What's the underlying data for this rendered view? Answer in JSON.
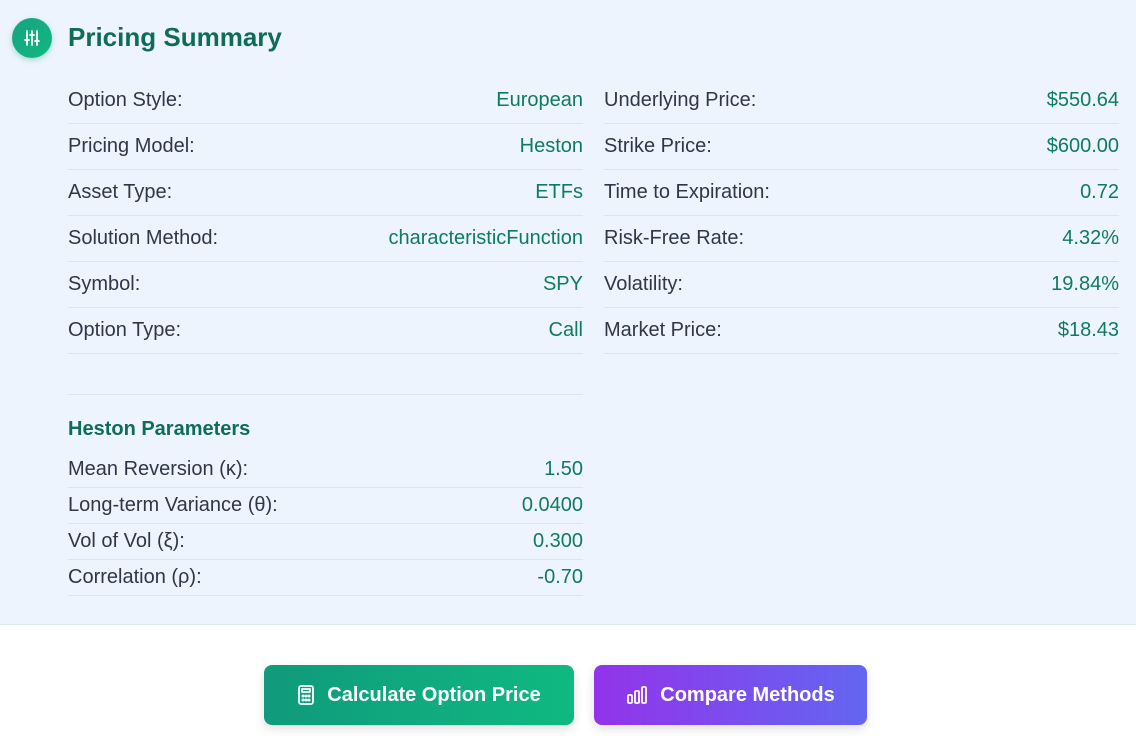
{
  "header": {
    "title": "Pricing Summary",
    "icon": "sliders-icon"
  },
  "summary_left": [
    {
      "label": "Option Style:",
      "value": "European"
    },
    {
      "label": "Pricing Model:",
      "value": "Heston"
    },
    {
      "label": "Asset Type:",
      "value": "ETFs"
    },
    {
      "label": "Solution Method:",
      "value": "characteristicFunction"
    },
    {
      "label": "Symbol:",
      "value": "SPY"
    },
    {
      "label": "Option Type:",
      "value": "Call"
    }
  ],
  "summary_right": [
    {
      "label": "Underlying Price:",
      "value": "$550.64"
    },
    {
      "label": "Strike Price:",
      "value": "$600.00"
    },
    {
      "label": "Time to Expiration:",
      "value": "0.72"
    },
    {
      "label": "Risk-Free Rate:",
      "value": "4.32%"
    },
    {
      "label": "Volatility:",
      "value": "19.84%"
    },
    {
      "label": "Market Price:",
      "value": "$18.43"
    }
  ],
  "heston": {
    "title": "Heston Parameters",
    "params": [
      {
        "label": "Mean Reversion (κ):",
        "value": "1.50"
      },
      {
        "label": "Long-term Variance (θ):",
        "value": "0.0400"
      },
      {
        "label": "Vol of Vol (ξ):",
        "value": "0.300"
      },
      {
        "label": "Correlation (ρ):",
        "value": "-0.70"
      }
    ]
  },
  "buttons": {
    "calculate_label": "Calculate Option Price",
    "calculate_icon": "calculator-icon",
    "compare_label": "Compare Methods",
    "compare_icon": "bar-chart-icon"
  },
  "colors": {
    "accent_green": "#0f7a63",
    "title_green": "#0f6b5a",
    "panel_bg": "#eef4fd",
    "purple": "#9333ea",
    "indigo": "#6366f1"
  }
}
